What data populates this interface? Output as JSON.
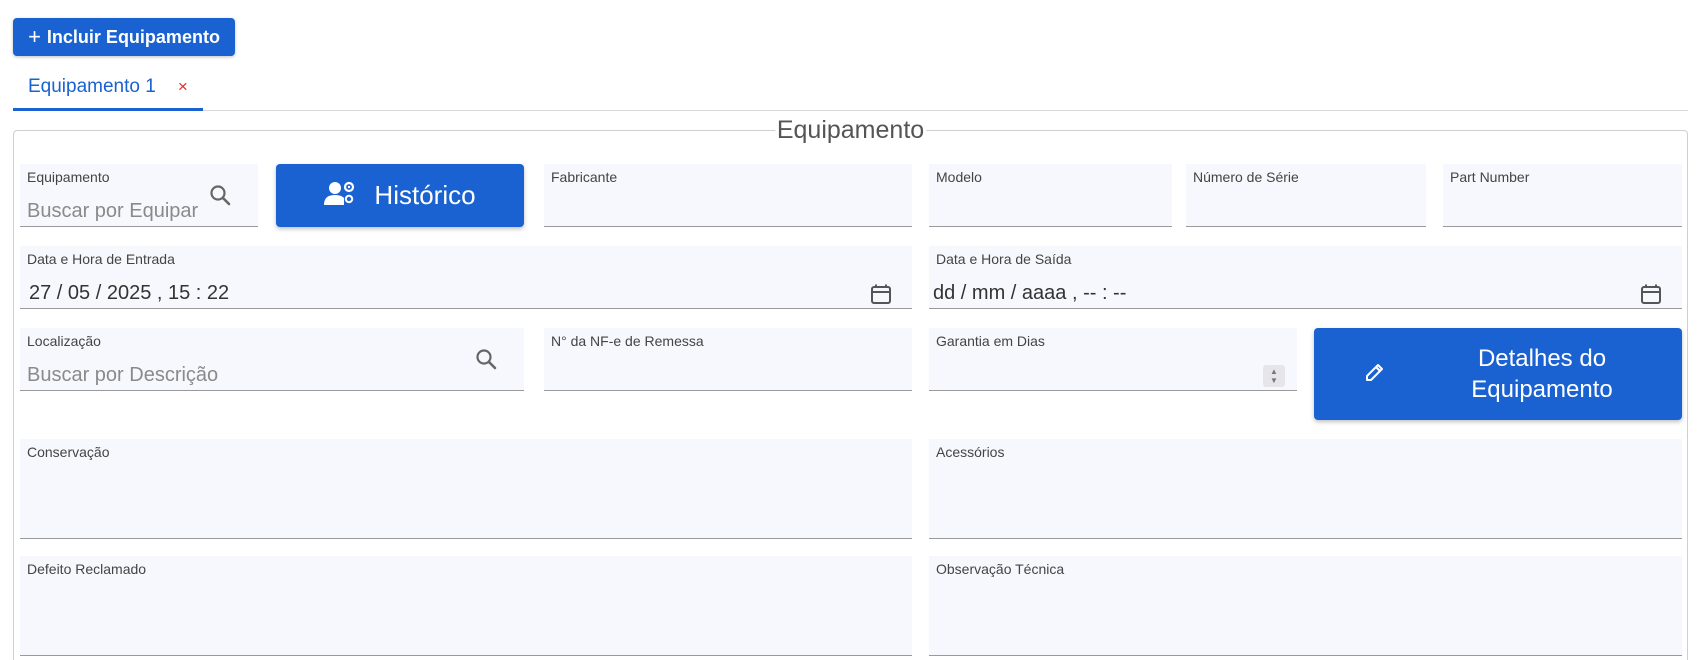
{
  "toolbar": {
    "add_label": "Incluir Equipamento",
    "add_icon": "plus-icon"
  },
  "tabs": [
    {
      "label": "Equipamento 1",
      "close": "×"
    }
  ],
  "section": {
    "legend": "Equipamento"
  },
  "fields": {
    "equipamento": {
      "label": "Equipamento",
      "placeholder": "Buscar por Equipar",
      "icon": "search-icon"
    },
    "fabricante": {
      "label": "Fabricante",
      "value": ""
    },
    "modelo": {
      "label": "Modelo",
      "value": ""
    },
    "numero_serie": {
      "label": "Número de Série",
      "value": ""
    },
    "part_number": {
      "label": "Part Number",
      "value": ""
    },
    "data_entrada": {
      "label": "Data e Hora de Entrada",
      "value": "27 / 05 / 2025 ,  15 : 22",
      "icon": "calendar-icon"
    },
    "data_saida": {
      "label": "Data e Hora de Saída",
      "value": "dd / mm / aaaa ,  -- : --",
      "icon": "calendar-icon"
    },
    "localizacao": {
      "label": "Localização",
      "placeholder": "Buscar por Descrição",
      "icon": "search-icon"
    },
    "nf_remessa": {
      "label": "N° da NF-e de Remessa",
      "value": ""
    },
    "garantia": {
      "label": "Garantia em Dias",
      "value": ""
    },
    "conservacao": {
      "label": "Conservação",
      "value": ""
    },
    "acessorios": {
      "label": "Acessórios",
      "value": ""
    },
    "defeito": {
      "label": "Defeito Reclamado",
      "value": ""
    },
    "observacao": {
      "label": "Observação Técnica",
      "value": ""
    }
  },
  "buttons": {
    "historico": {
      "label": "Histórico",
      "icon": "user-settings-icon"
    },
    "detalhes": {
      "label": "Detalhes do Equipamento",
      "icon": "pencil-icon"
    }
  },
  "colors": {
    "primary": "#1a62d1",
    "field_bg": "#f7f8fd",
    "close": "#d93025"
  }
}
